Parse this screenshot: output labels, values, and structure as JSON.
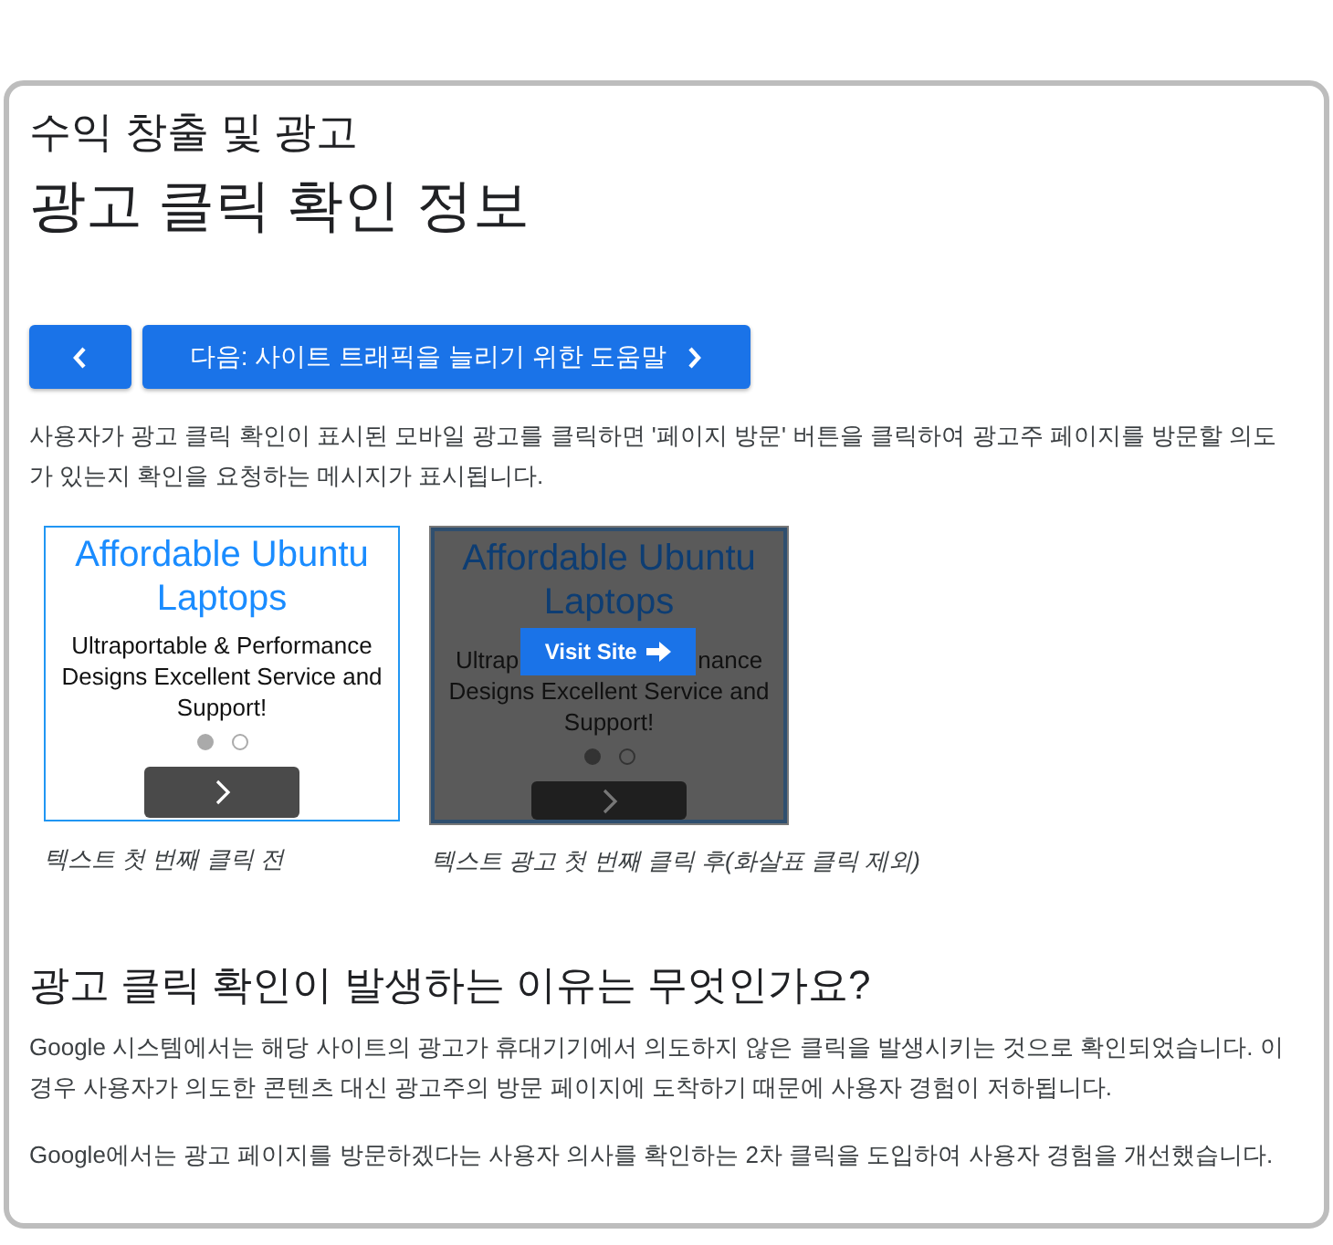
{
  "section": "수익 창출 및 광고",
  "title": "광고 클릭 확인 정보",
  "nav": {
    "next_label": "다음: 사이트 트래픽을 늘리기 위한 도움말"
  },
  "intro": "사용자가 광고 클릭 확인이 표시된 모바일 광고를 클릭하면 '페이지 방문' 버튼을 클릭하여 광고주 페이지를 방문할 의도가 있는지 확인을 요청하는 메시지가 표시됩니다.",
  "figures": [
    {
      "dimmed": false,
      "headline": "Affordable Ubuntu Laptops",
      "body": "Ultraportable & Performance Designs Excellent Service and Support!",
      "dots": [
        {
          "selected": true
        },
        {
          "selected": false
        }
      ],
      "caption": "텍스트 첫 번째 클릭 전"
    },
    {
      "dimmed": true,
      "headline": "Affordable Ubuntu Laptops",
      "body_start": "Ultrap",
      "body_end": "nance",
      "body": "Designs Excellent Service and Support!",
      "dots": [
        {
          "selected": true
        },
        {
          "selected": false
        }
      ],
      "overlay_button": "Visit Site",
      "caption": "텍스트 광고 첫 번째 클릭 후(화살표 클릭 제외)"
    }
  ],
  "subheading": "광고 클릭 확인이 발생하는 이유는 무엇인가요?",
  "paragraphs": [
    "Google 시스템에서는 해당 사이트의 광고가 휴대기기에서 의도하지 않은 클릭을 발생시키는 것으로 확인되었습니다. 이 경우 사용자가 의도한 콘텐츠 대신 광고주의 방문 페이지에 도착하기 때문에 사용자 경험이 저하됩니다.",
    "Google에서는 광고 페이지를 방문하겠다는 사용자 의사를 확인하는 2차 클릭을 도입하여 사용자 경험을 개선했습니다."
  ]
}
